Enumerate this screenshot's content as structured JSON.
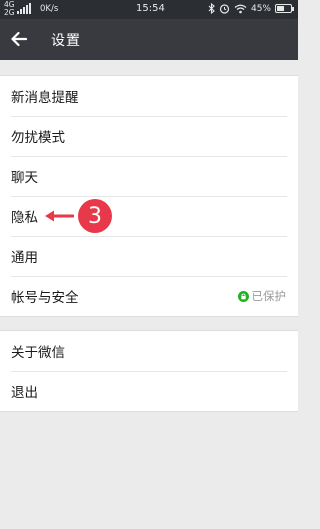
{
  "status_bar": {
    "network_top": "4G",
    "network_bottom": "2G",
    "speed": "0K/s",
    "time": "15:54",
    "battery": "45%",
    "battery_level": 0.45,
    "icons": [
      "signal-icon",
      "bluetooth-icon",
      "alarm-icon",
      "wifi-icon",
      "battery-icon"
    ]
  },
  "header": {
    "title": "设置",
    "back_icon": "back-arrow-icon"
  },
  "groups": [
    {
      "items": [
        {
          "label": "新消息提醒"
        },
        {
          "label": "勿扰模式"
        },
        {
          "label": "聊天"
        },
        {
          "label": "隐私"
        },
        {
          "label": "通用"
        },
        {
          "label": "帐号与安全",
          "status": "已保护",
          "status_icon": "lock-icon"
        }
      ]
    },
    {
      "items": [
        {
          "label": "关于微信"
        },
        {
          "label": "退出"
        }
      ]
    }
  ],
  "annotation": {
    "number": "3",
    "color": "#e8394a"
  },
  "colors": {
    "nav": "#393a3f",
    "status": "#2b2f33",
    "background": "#ebebeb",
    "protected": "#21b121"
  }
}
